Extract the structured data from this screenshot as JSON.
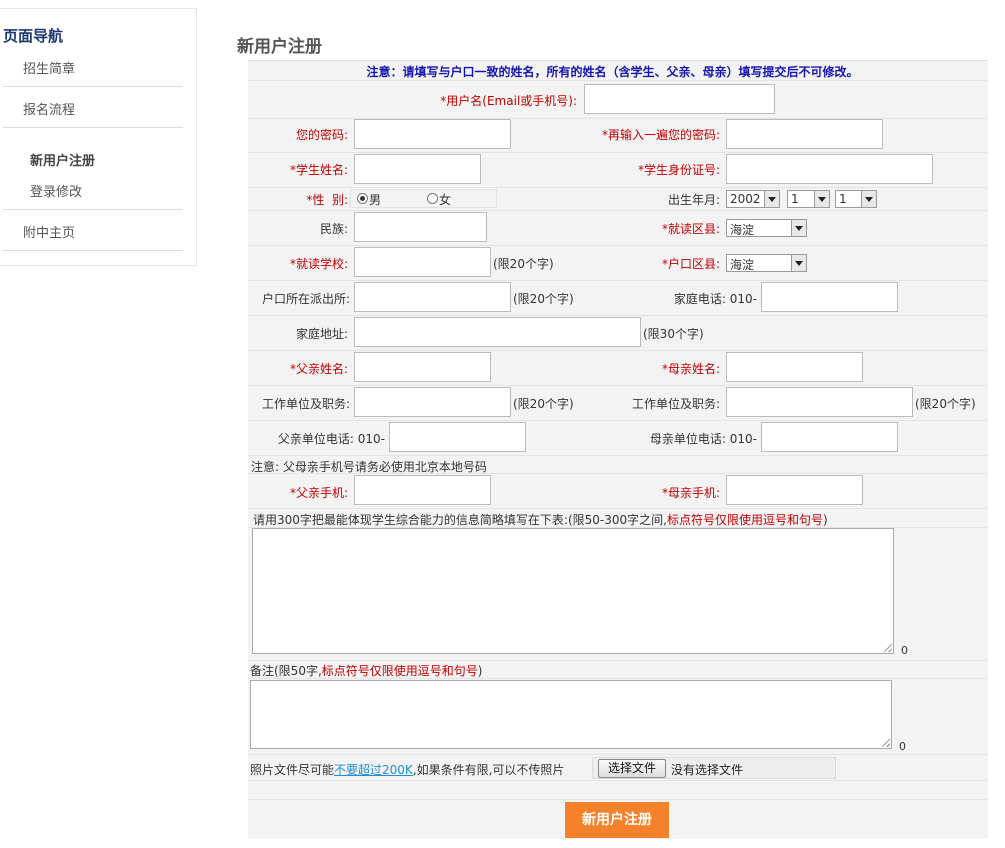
{
  "sidebar": {
    "title": "页面导航",
    "items": [
      {
        "label": "招生简章"
      },
      {
        "label": "报名流程"
      },
      {
        "label": "新用户注册"
      },
      {
        "label": "登录修改"
      },
      {
        "label": "附中主页"
      }
    ]
  },
  "page_title": "新用户注册",
  "form": {
    "notice": "注意：请填写与户口一致的姓名，所有的姓名（含学生、父亲、母亲）填写提交后不可修改。",
    "username_label": "*用户名(Email或手机号):",
    "password_label": "您的密码:",
    "password2_label": "*再输入一遍您的密码:",
    "student_name_label": "*学生姓名:",
    "student_id_label": "*学生身份证号:",
    "gender_label": "*性  别:",
    "gender_male": "男",
    "gender_female": "女",
    "gender_selected": "男",
    "birth_label": "出生年月:",
    "birth_year": "2002",
    "birth_month": "1",
    "birth_day": "1",
    "ethnicity_label": "民族:",
    "school_district_label": "*就读区县:",
    "school_district_value": "海淀",
    "school_label": "*就读学校:",
    "limit20": "(限20个字)",
    "hukou_district_label": "*户口区县:",
    "hukou_district_value": "海淀",
    "police_label": "户口所在派出所:",
    "home_phone_label": "家庭电话: 010-",
    "address_label": "家庭地址:",
    "limit30": "(限30个字)",
    "father_name_label": "*父亲姓名:",
    "mother_name_label": "*母亲姓名:",
    "father_work_label": "工作单位及职务:",
    "mother_work_label": "工作单位及职务:",
    "father_work_phone_label": "父亲单位电话: 010-",
    "mother_work_phone_label": "母亲单位电话: 010-",
    "phone_notice": "注意: 父母亲手机号请务必使用北京本地号码",
    "father_mobile_label": "*父亲手机:",
    "mother_mobile_label": "*母亲手机:",
    "summary_label_a": "请用300字把最能体现学生综合能力的信息简略填写在下表:(限50-300字之间,",
    "summary_label_b": "标点符号仅限使用逗号和句号",
    "summary_label_c": ")",
    "summary_count": "0",
    "remark_label_a": "备注(限50字,",
    "remark_label_b": "标点符号仅限使用逗号和句号",
    "remark_label_c": ")",
    "remark_count": "0",
    "photo_a": "照片文件尽可能",
    "photo_link": "不要超过200K",
    "photo_b": ",如果条件有限,可以不传照片",
    "file_button": "选择文件",
    "file_status": "没有选择文件",
    "submit": "新用户注册"
  },
  "colors": {
    "accent": "#f5822a",
    "required": "#c00000",
    "notice": "#1515b0",
    "nav_title": "#1d3a70"
  }
}
